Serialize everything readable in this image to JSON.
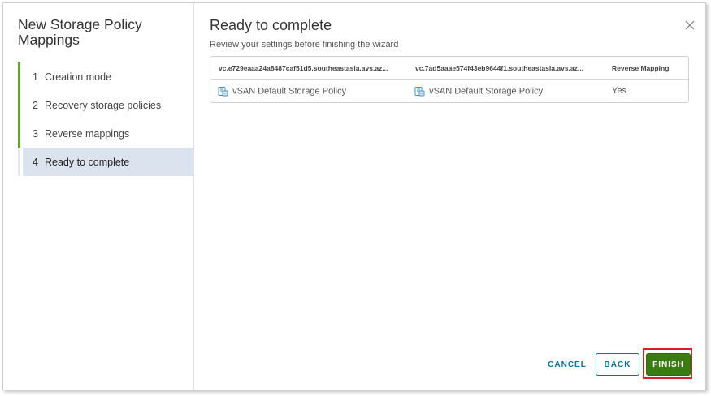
{
  "sidebar": {
    "title": "New Storage Policy Mappings",
    "steps": [
      {
        "num": "1",
        "label": "Creation mode"
      },
      {
        "num": "2",
        "label": "Recovery storage policies"
      },
      {
        "num": "3",
        "label": "Reverse mappings"
      },
      {
        "num": "4",
        "label": "Ready to complete"
      }
    ]
  },
  "main": {
    "title": "Ready to complete",
    "subtitle": "Review your settings before finishing the wizard",
    "table": {
      "headers": [
        "vc.e729eaaa24a8487caf51d5.southeastasia.avs.az...",
        "vc.7ad5aaae574f43eb9644f1.southeastasia.avs.az...",
        "Reverse Mapping"
      ],
      "rows": [
        {
          "source": "vSAN Default Storage Policy",
          "target": "vSAN Default Storage Policy",
          "reverse": "Yes"
        }
      ]
    }
  },
  "footer": {
    "cancel_label": "CANCEL",
    "back_label": "BACK",
    "finish_label": "FINISH"
  },
  "colors": {
    "accent": "#62a420",
    "finish": "#3a7c13",
    "link": "#0072a3",
    "highlight_outline": "#d32029",
    "current_step_bg": "#dbe4ee"
  },
  "icons": {
    "close": "close-icon",
    "policy": "storage-policy-icon"
  }
}
